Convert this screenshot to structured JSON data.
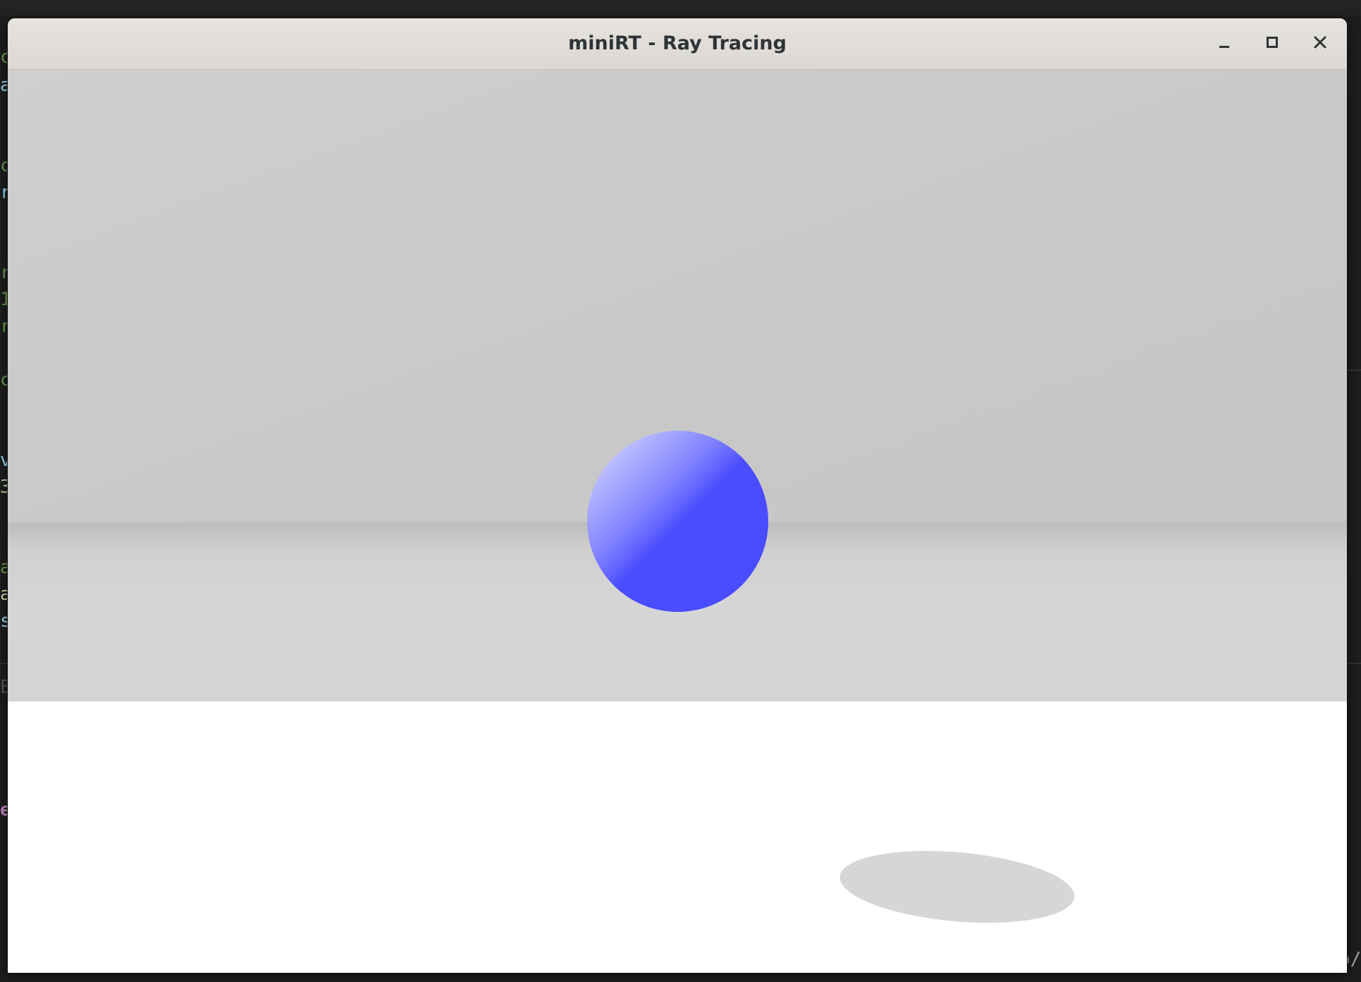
{
  "window": {
    "title": "miniRT - Ray Tracing",
    "controls": {
      "minimize_icon": "minimize-icon",
      "maximize_icon": "maximize-icon",
      "close_icon": "close-icon"
    }
  },
  "scene": {
    "objects": [
      {
        "type": "sphere",
        "color": "#4a4cff"
      },
      {
        "type": "plane-wall",
        "color": "#c9c9c9"
      },
      {
        "type": "plane-floor",
        "color": "#d6d6d6"
      },
      {
        "type": "ground",
        "color": "#ffffff"
      },
      {
        "type": "shadow",
        "color": "#d6d6d6"
      }
    ]
  },
  "background_fragments": {
    "left_column": [
      "c",
      "a",
      "c",
      "r",
      "r",
      "1",
      "r",
      "c",
      "v",
      "3",
      "a",
      "a",
      "s",
      "E",
      "e"
    ],
    "right_text": "o/"
  }
}
